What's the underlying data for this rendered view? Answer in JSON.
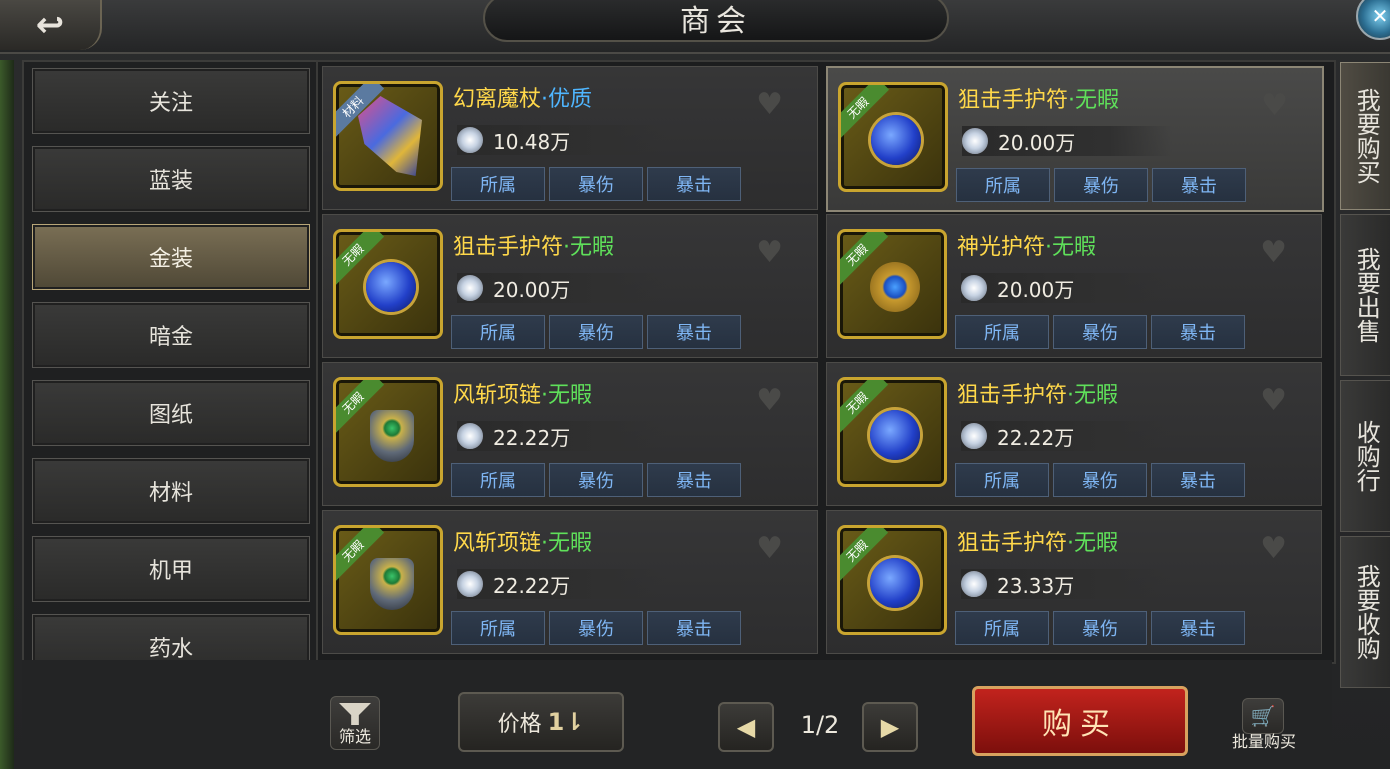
{
  "header": {
    "title": "商会"
  },
  "categories": [
    {
      "label": "关注",
      "active": false
    },
    {
      "label": "蓝装",
      "active": false
    },
    {
      "label": "金装",
      "active": true
    },
    {
      "label": "暗金",
      "active": false
    },
    {
      "label": "图纸",
      "active": false
    },
    {
      "label": "材料",
      "active": false
    },
    {
      "label": "机甲",
      "active": false
    },
    {
      "label": "药水",
      "active": false
    }
  ],
  "items": [
    {
      "name": "幻离魔杖",
      "quality": "·优质",
      "badge": "材料",
      "price": "10.48万",
      "tags": [
        "所属",
        "暴伤",
        "暴击"
      ]
    },
    {
      "name": "狙击手护符",
      "quality": "·无暇",
      "badge": "无暇",
      "price": "20.00万",
      "tags": [
        "所属",
        "暴伤",
        "暴击"
      ]
    },
    {
      "name": "狙击手护符",
      "quality": "·无暇",
      "badge": "无暇",
      "price": "20.00万",
      "tags": [
        "所属",
        "暴伤",
        "暴击"
      ]
    },
    {
      "name": "神光护符",
      "quality": "·无暇",
      "badge": "无暇",
      "price": "20.00万",
      "tags": [
        "所属",
        "暴伤",
        "暴击"
      ]
    },
    {
      "name": "风斩项链",
      "quality": "·无暇",
      "badge": "无暇",
      "price": "22.22万",
      "tags": [
        "所属",
        "暴伤",
        "暴击"
      ]
    },
    {
      "name": "狙击手护符",
      "quality": "·无暇",
      "badge": "无暇",
      "price": "22.22万",
      "tags": [
        "所属",
        "暴伤",
        "暴击"
      ]
    },
    {
      "name": "风斩项链",
      "quality": "·无暇",
      "badge": "无暇",
      "price": "22.22万",
      "tags": [
        "所属",
        "暴伤",
        "暴击"
      ]
    },
    {
      "name": "狙击手护符",
      "quality": "·无暇",
      "badge": "无暇",
      "price": "23.33万",
      "tags": [
        "所属",
        "暴伤",
        "暴击"
      ]
    }
  ],
  "right_tabs": [
    {
      "label": "我要购买",
      "active": true
    },
    {
      "label": "我要出售",
      "active": false
    },
    {
      "label": "收购行",
      "active": false
    },
    {
      "label": "我要收购",
      "active": false
    }
  ],
  "footer": {
    "filter_label": "筛选",
    "sort_label": "价格",
    "page": "1/2",
    "buy_label": "购买",
    "bulk_label": "批量购买"
  },
  "icons": {
    "back": "back-arrow-icon",
    "close": "close-orb-icon",
    "heart": "heart-icon",
    "coin": "silver-coin-icon",
    "filter": "funnel-icon",
    "sort": "sort-icon",
    "prev": "triangle-left-icon",
    "next": "triangle-right-icon",
    "cart": "cart-icon"
  },
  "colors": {
    "item_name": "#ffd84a",
    "quality_excellent": "#4fb6ff",
    "quality_flawless": "#5fe05a",
    "tag_text": "#7fb6f4",
    "buy_button": "#c2231d"
  }
}
